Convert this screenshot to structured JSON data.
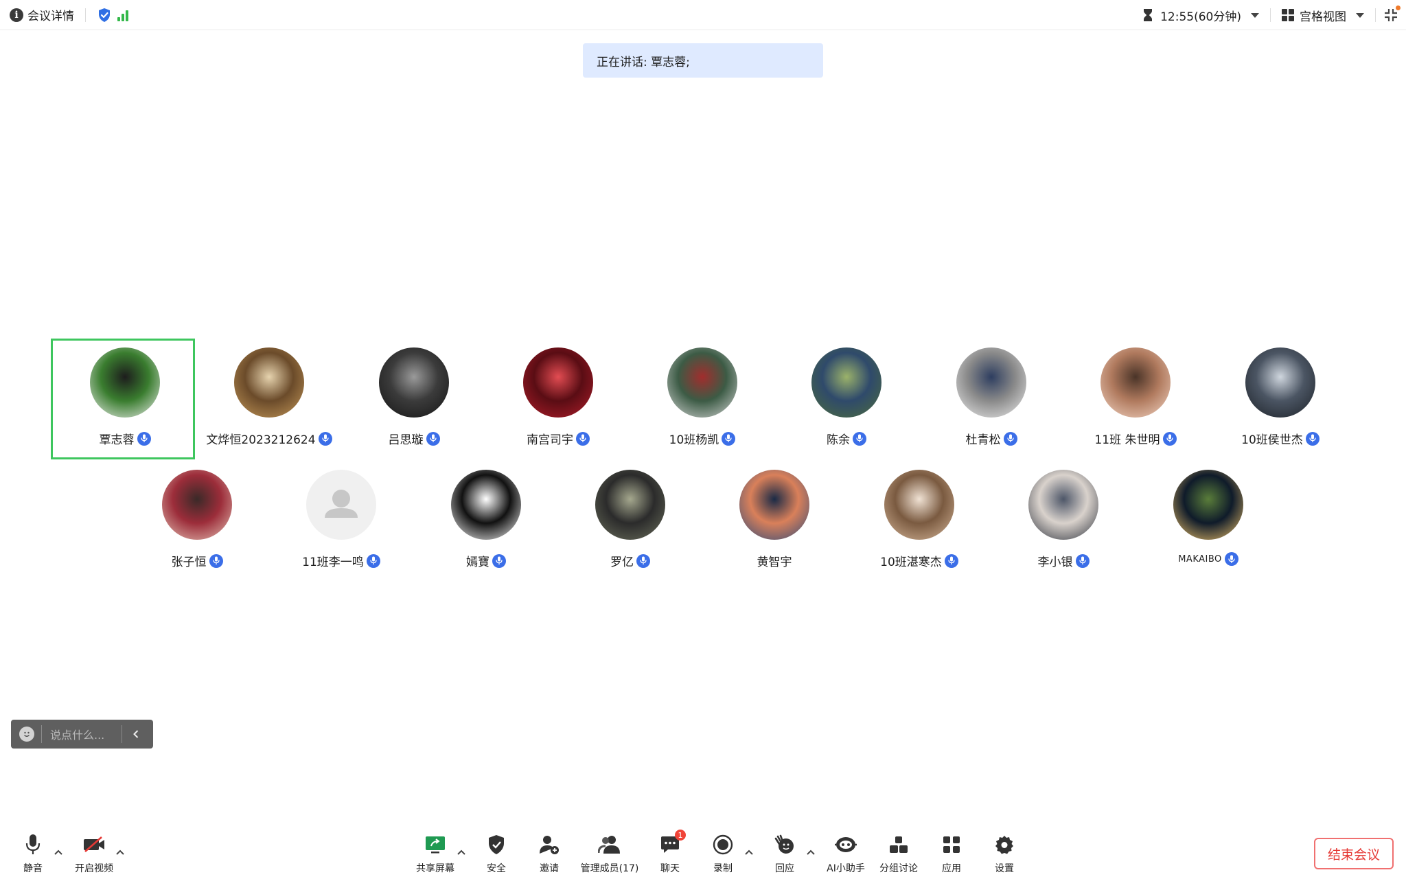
{
  "topbar": {
    "title": "会议详情",
    "timer": "12:55(60分钟)",
    "view_label": "宫格视图"
  },
  "speaking_banner": "正在讲话: 覃志蓉;",
  "participants": [
    {
      "name": "覃志蓉",
      "active": true,
      "colors": [
        "#f1f1f1",
        "#3a7d2f",
        "#1d1d1d"
      ]
    },
    {
      "name": "文烨恒2023212624",
      "colors": [
        "#c69a5a",
        "#6b4b2a",
        "#e6d3ae"
      ]
    },
    {
      "name": "吕思璇",
      "colors": [
        "#141414",
        "#3b3b3b",
        "#9a9a9a"
      ]
    },
    {
      "name": "南宫司宇",
      "colors": [
        "#b21e2b",
        "#5a0d14",
        "#e24c52"
      ]
    },
    {
      "name": "10班杨凯",
      "colors": [
        "#d8d8d8",
        "#3c5b45",
        "#a12d2d"
      ]
    },
    {
      "name": "陈余",
      "colors": [
        "#4d6d3b",
        "#2f4a6b",
        "#9bb26a"
      ]
    },
    {
      "name": "杜青松",
      "colors": [
        "#eeeeee",
        "#8a8a8a",
        "#2e3e60"
      ]
    },
    {
      "name": "11班 朱世明",
      "colors": [
        "#f4d7c6",
        "#b07a5e",
        "#4a3428"
      ]
    },
    {
      "name": "10班侯世杰",
      "colors": [
        "#1b2026",
        "#4b5563",
        "#cfd6de"
      ]
    },
    {
      "name": "张子恒",
      "colors": [
        "#e6c4b7",
        "#9c2d3a",
        "#3a2a28"
      ]
    },
    {
      "name": "11班李一鸣",
      "placeholder": true,
      "colors": [
        "#f0f0f0",
        "#c7c7c7",
        "#c7c7c7"
      ]
    },
    {
      "name": "嫣寶",
      "colors": [
        "#ffffff",
        "#111111",
        "#ffffff"
      ]
    },
    {
      "name": "罗亿",
      "colors": [
        "#6b6f5c",
        "#2b2b2b",
        "#a5a88e"
      ]
    },
    {
      "name": "黄智宇",
      "mic": false,
      "colors": [
        "#2c4a7a",
        "#d9805a",
        "#1a2a46"
      ]
    },
    {
      "name": "10班湛寒杰",
      "colors": [
        "#d6b79a",
        "#7a5a40",
        "#f0e2d4"
      ]
    },
    {
      "name": "李小银",
      "colors": [
        "#2a2f3a",
        "#d9d2cc",
        "#4d5668"
      ]
    },
    {
      "name": "MAKAIBO",
      "small": true,
      "colors": [
        "#f2c46a",
        "#0f1b2a",
        "#5a7d3a"
      ]
    }
  ],
  "chat_input": {
    "placeholder": "说点什么..."
  },
  "toolbar": {
    "mute": "静音",
    "video": "开启视频",
    "share": "共享屏幕",
    "security": "安全",
    "invite": "邀请",
    "members": "管理成员(17)",
    "chat": "聊天",
    "chat_badge": "1",
    "record": "录制",
    "react": "回应",
    "ai": "AI小助手",
    "breakout": "分组讨论",
    "apps": "应用",
    "settings": "设置",
    "end": "结束会议"
  },
  "colors": {
    "accent": "#3b6ee8",
    "active_border": "#3ec65e",
    "end": "#e53935",
    "banner": "#dfeaff"
  }
}
